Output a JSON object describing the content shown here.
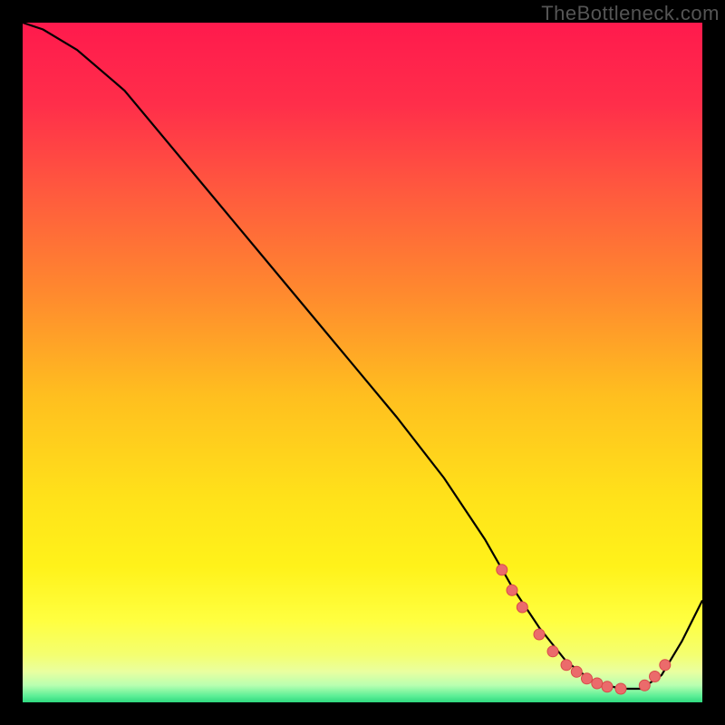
{
  "watermark": "TheBottleneck.com",
  "colors": {
    "frame": "#000000",
    "watermark_text": "#555555",
    "curve": "#000000",
    "dot_fill": "#eb6b6b",
    "dot_stroke": "#d94a4a",
    "gradient_stops": [
      {
        "offset": 0.0,
        "color": "#ff1a4d"
      },
      {
        "offset": 0.12,
        "color": "#ff2e4a"
      },
      {
        "offset": 0.25,
        "color": "#ff5a3e"
      },
      {
        "offset": 0.4,
        "color": "#ff8a2e"
      },
      {
        "offset": 0.55,
        "color": "#ffbf1f"
      },
      {
        "offset": 0.7,
        "color": "#ffe21a"
      },
      {
        "offset": 0.8,
        "color": "#fff21a"
      },
      {
        "offset": 0.88,
        "color": "#ffff40"
      },
      {
        "offset": 0.93,
        "color": "#f4ff70"
      },
      {
        "offset": 0.955,
        "color": "#e9ffa0"
      },
      {
        "offset": 0.975,
        "color": "#b8ffb0"
      },
      {
        "offset": 0.99,
        "color": "#60f098"
      },
      {
        "offset": 1.0,
        "color": "#2fd97f"
      }
    ]
  },
  "chart_data": {
    "type": "line",
    "title": "",
    "xlabel": "",
    "ylabel": "",
    "x_range": [
      0,
      100
    ],
    "y_range": [
      0,
      100
    ],
    "series": [
      {
        "name": "bottleneck-curve",
        "x": [
          0,
          3,
          8,
          15,
          25,
          35,
          45,
          55,
          62,
          68,
          72,
          76,
          80,
          84,
          88,
          91,
          94,
          97,
          100
        ],
        "y": [
          100,
          99,
          96,
          90,
          78,
          66,
          54,
          42,
          33,
          24,
          17,
          11,
          6,
          3,
          2,
          2,
          4,
          9,
          15
        ]
      }
    ],
    "dots": {
      "name": "highlight-dots",
      "x": [
        70.5,
        72.0,
        73.5,
        76.0,
        78.0,
        80.0,
        81.5,
        83.0,
        84.5,
        86.0,
        88.0,
        91.5,
        93.0,
        94.5
      ],
      "y": [
        19.5,
        16.5,
        14.0,
        10.0,
        7.5,
        5.5,
        4.5,
        3.5,
        2.8,
        2.3,
        2.0,
        2.5,
        3.8,
        5.5
      ]
    }
  }
}
